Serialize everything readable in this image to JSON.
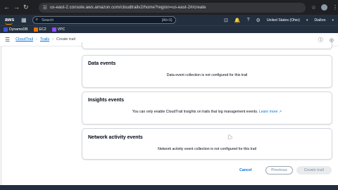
{
  "browser": {
    "url": "us-east-2.console.aws.amazon.com/cloudtrailv2/home?region=us-east-2#/create"
  },
  "aws_nav": {
    "logo": "aws",
    "search_placeholder": "Search",
    "search_shortcut": "[Alt+S]",
    "region": "United States (Ohio)",
    "account": "Dialton"
  },
  "favorites": [
    {
      "label": "DynamoDB",
      "color": "#4053d6"
    },
    {
      "label": "EC2",
      "color": "#ed7100"
    },
    {
      "label": "VPC",
      "color": "#8c4fff"
    }
  ],
  "breadcrumb": {
    "items": [
      "CloudTrail",
      "Trails"
    ],
    "current": "Create trail"
  },
  "panels": {
    "data_events": {
      "title": "Data events",
      "message": "Data event collection is not configured for this trail"
    },
    "insights_events": {
      "title": "Insights events",
      "message": "You can only enable CloudTrail Insights on trails that log management events.",
      "link": "Learn more"
    },
    "network_events": {
      "title": "Network activity events",
      "message": "Network activity event collection is not configured for this trail"
    }
  },
  "actions": {
    "cancel": "Cancel",
    "previous": "Previous",
    "create": "Create trail"
  }
}
